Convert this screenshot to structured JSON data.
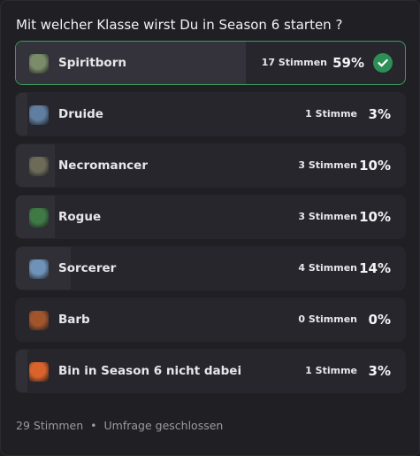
{
  "poll": {
    "question": "Mit welcher Klasse wirst Du in Season 6 starten ?",
    "answers": [
      {
        "label": "Spiritborn",
        "votes": "17 Stimmen",
        "percent": "59%",
        "fraction": 0.59,
        "selected": true,
        "icon": "spiritborn-emoji-icon",
        "color": "#7a8c6a"
      },
      {
        "label": "Druide",
        "votes": "1 Stimme",
        "percent": "3%",
        "fraction": 0.03,
        "selected": false,
        "icon": "druid-emoji-icon",
        "color": "#5f7ea0"
      },
      {
        "label": "Necromancer",
        "votes": "3 Stimmen",
        "percent": "10%",
        "fraction": 0.1,
        "selected": false,
        "icon": "necromancer-emoji-icon",
        "color": "#6d6b58"
      },
      {
        "label": "Rogue",
        "votes": "3 Stimmen",
        "percent": "10%",
        "fraction": 0.1,
        "selected": false,
        "icon": "rogue-emoji-icon",
        "color": "#3f7a45"
      },
      {
        "label": "Sorcerer",
        "votes": "4 Stimmen",
        "percent": "14%",
        "fraction": 0.14,
        "selected": false,
        "icon": "sorcerer-emoji-icon",
        "color": "#6f92b8"
      },
      {
        "label": "Barb",
        "votes": "0 Stimmen",
        "percent": "0%",
        "fraction": 0.0,
        "selected": false,
        "icon": "barbarian-emoji-icon",
        "color": "#a0552d"
      },
      {
        "label": "Bin in Season 6 nicht dabei",
        "votes": "1 Stimme",
        "percent": "3%",
        "fraction": 0.03,
        "selected": false,
        "icon": "crab-emoji-icon",
        "color": "#d9632b"
      }
    ],
    "total_votes": "29 Stimmen",
    "separator": "•",
    "status": "Umfrage geschlossen",
    "check_icon": "check-circle-icon",
    "accent_color": "#2d8f55"
  }
}
